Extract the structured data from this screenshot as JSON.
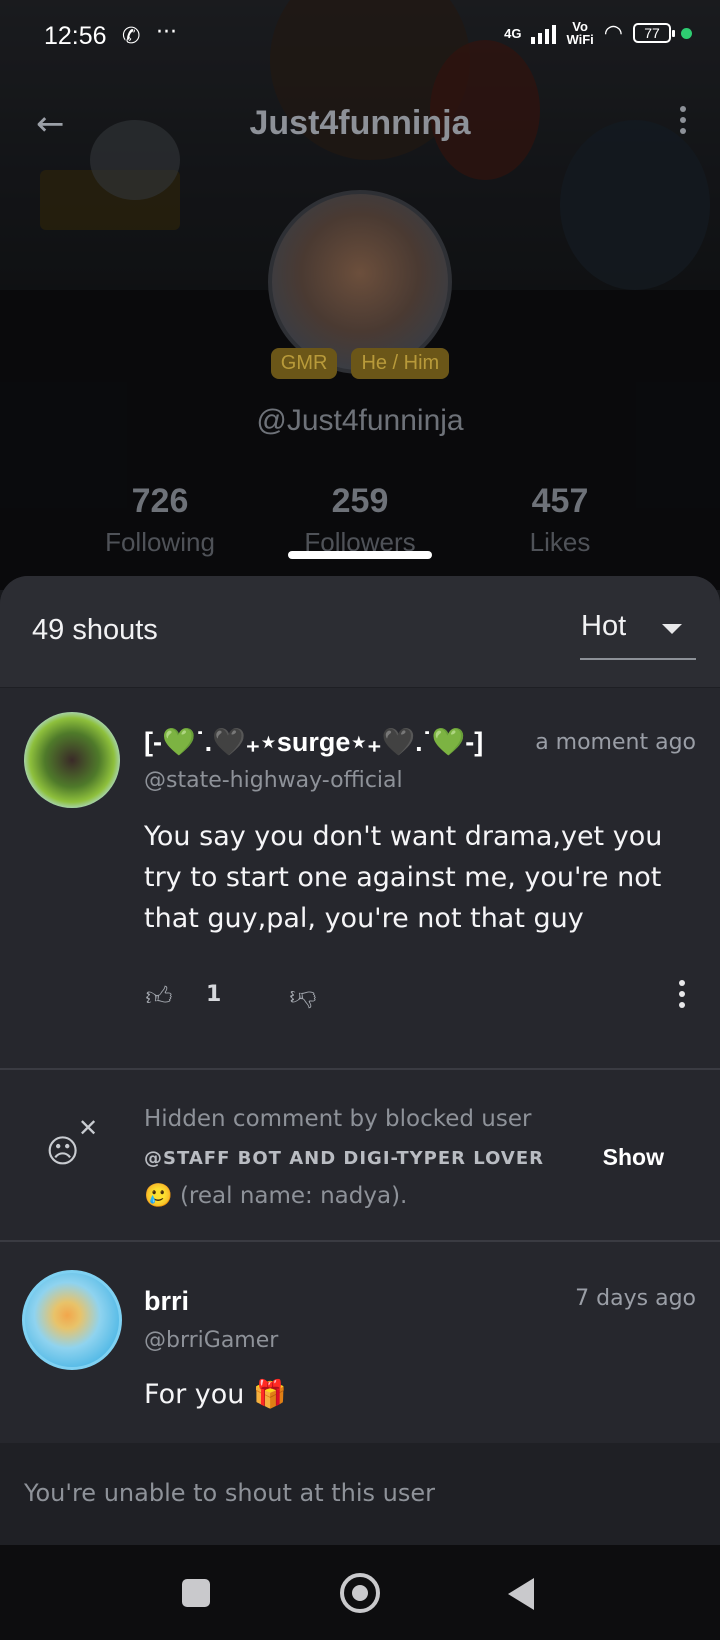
{
  "status_bar": {
    "time": "12:56",
    "network": "4G",
    "wifi_label_top": "Vo",
    "wifi_label_bottom": "WiFi",
    "battery": "77"
  },
  "profile": {
    "title": "Just4funninja",
    "tags": [
      "GMR",
      "He / Him"
    ],
    "handle": "@Just4funninja",
    "stats": [
      {
        "value": "726",
        "label": "Following"
      },
      {
        "value": "259",
        "label": "Followers"
      },
      {
        "value": "457",
        "label": "Likes"
      }
    ]
  },
  "sheet": {
    "count": "49 shouts",
    "sort_label": "Hot"
  },
  "shouts": [
    {
      "name": "[-💚˙.🖤₊⋆surge⋆₊🖤.˙💚-]",
      "time": "a moment ago",
      "username": "@state-highway-official",
      "text": "You say you don't want drama,yet you try to start one against me, you're not that guy,pal, you're not that guy",
      "likes": "1"
    },
    {
      "hidden_line": "Hidden comment by blocked user",
      "username": "@STAFF BOT AND DIGI-TYPER LOVER",
      "bio": "🥲 (real name: nadya).",
      "show_label": "Show"
    },
    {
      "name": "brri",
      "time": "7 days ago",
      "username": "@brriGamer",
      "text": "For you 🎁"
    }
  ],
  "blocked_notice": "You're unable to shout at this user",
  "colors": {
    "sheet_bg": "#26272d",
    "tag_bg": "#6b5618",
    "online_dot": "#2ecc71"
  }
}
